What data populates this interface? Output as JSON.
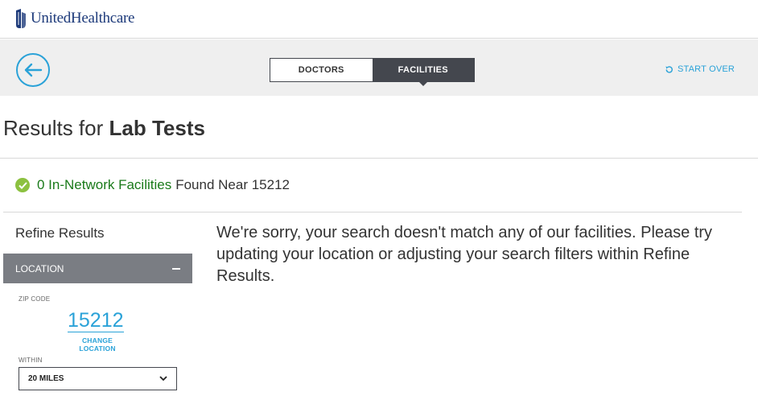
{
  "header": {
    "brand": "UnitedHealthcare"
  },
  "nav": {
    "tabs": [
      {
        "label": "DOCTORS",
        "active": false
      },
      {
        "label": "FACILITIES",
        "active": true
      }
    ],
    "start_over": "START OVER"
  },
  "results": {
    "title_prefix": "Results for ",
    "title_term": "Lab Tests",
    "status_count": "0 In-Network Facilities",
    "status_rest": "Found Near 15212"
  },
  "sidebar": {
    "refine_title": "Refine Results",
    "location_header": "LOCATION",
    "zip_label": "ZIP CODE",
    "zip_value": "15212",
    "change_location_line1": "CHANGE",
    "change_location_line2": "LOCATION",
    "within_label": "WITHIN",
    "within_value": "20 MILES"
  },
  "message": "We're sorry, your search doesn't match any of our facilities. Please try updating your location or adjusting your search filters within Refine Results.",
  "colors": {
    "accent": "#2aa2d8",
    "brand": "#1e3b7b",
    "success": "#1a7a1a",
    "check": "#8cc140",
    "dark": "#44474e",
    "header_gray": "#7a7d83"
  }
}
